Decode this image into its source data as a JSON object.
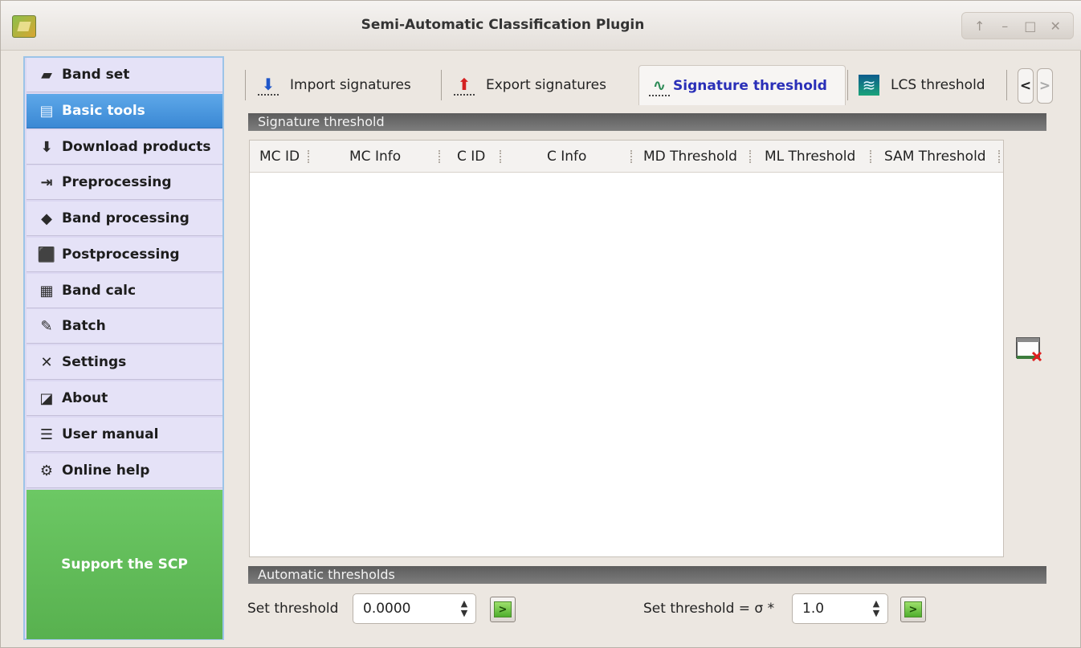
{
  "window": {
    "title": "Semi-Automatic Classification Plugin",
    "controls": [
      "↑",
      "–",
      "□",
      "✕"
    ]
  },
  "sidebar": {
    "items": [
      {
        "label": "Band set",
        "icon": "band-set-icon",
        "glyph": "▰"
      },
      {
        "label": "Basic tools",
        "icon": "basic-tools-icon",
        "glyph": "▤",
        "active": true
      },
      {
        "label": "Download products",
        "icon": "download-icon",
        "glyph": "⬇"
      },
      {
        "label": "Preprocessing",
        "icon": "preprocessing-icon",
        "glyph": "⇥"
      },
      {
        "label": "Band processing",
        "icon": "band-processing-icon",
        "glyph": "◆"
      },
      {
        "label": "Postprocessing",
        "icon": "postprocessing-icon",
        "glyph": "⬛"
      },
      {
        "label": "Band calc",
        "icon": "calculator-icon",
        "glyph": "▦"
      },
      {
        "label": "Batch",
        "icon": "batch-icon",
        "glyph": "✎"
      },
      {
        "label": "Settings",
        "icon": "settings-icon",
        "glyph": "✕"
      },
      {
        "label": "About",
        "icon": "about-icon",
        "glyph": "◪"
      },
      {
        "label": "User manual",
        "icon": "manual-icon",
        "glyph": "☰"
      },
      {
        "label": "Online help",
        "icon": "help-icon",
        "glyph": "⚙"
      }
    ],
    "support_label": "Support the SCP"
  },
  "tabs": [
    {
      "label": "Import signatures",
      "icon": "import-signatures-icon",
      "glyph": "⬇"
    },
    {
      "label": "Export signatures",
      "icon": "export-signatures-icon",
      "glyph": "⬆"
    },
    {
      "label": "Signature threshold",
      "icon": "signature-threshold-icon",
      "glyph": "∿",
      "active": true
    },
    {
      "label": "LCS threshold",
      "icon": "lcs-threshold-icon",
      "glyph": "≋"
    }
  ],
  "tab_nav": {
    "prev": "<",
    "next": ">"
  },
  "signature_section": {
    "title": "Signature threshold",
    "columns": [
      "MC ID",
      "MC Info",
      "C ID",
      "C Info",
      "MD Threshold",
      "ML Threshold",
      "SAM Threshold"
    ],
    "rows": []
  },
  "auto_section": {
    "title": "Automatic  thresholds",
    "set_threshold_label": "Set threshold",
    "set_threshold_value": "0.0000",
    "sigma_label": "Set threshold = σ *",
    "sigma_value": "1.0"
  },
  "colors": {
    "active_item": "#3a88d4",
    "support_bg": "#5fbd56",
    "active_tab_text": "#2a2fb8"
  }
}
